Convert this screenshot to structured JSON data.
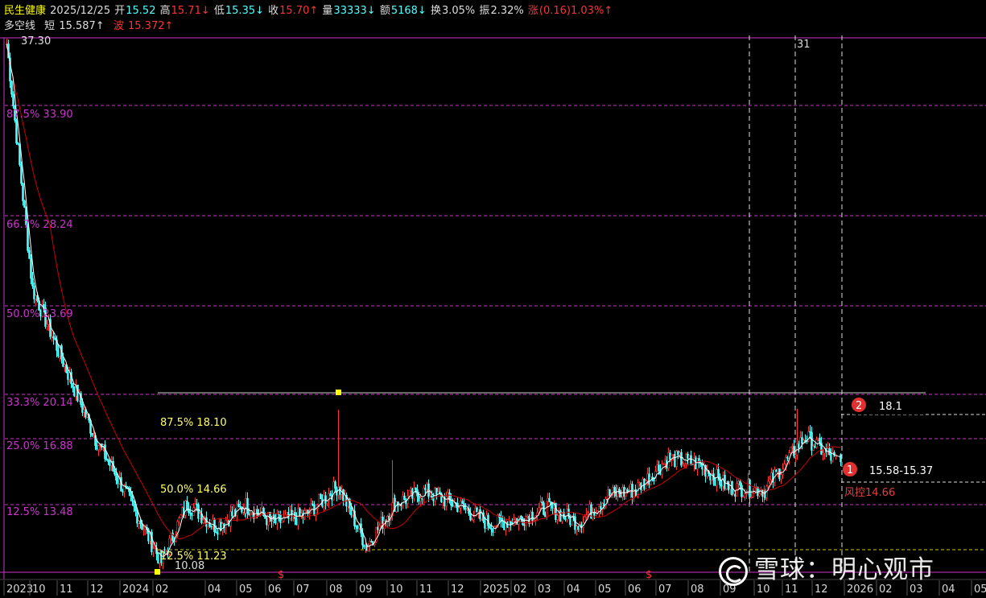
{
  "colors": {
    "bg": "#000000",
    "up": "#ff3232",
    "down": "#54ffff",
    "magenta": "#cc33cc",
    "yellow": "#ffff00",
    "white": "#ffffff",
    "grey": "#c8c8c8",
    "ma": "#cc0000"
  },
  "header": {
    "name": "民生健康",
    "date": "2025/12/25",
    "open_label": "开",
    "open_value": "15.52",
    "high_label": "高",
    "high_value": "15.71↓",
    "low_label": "低",
    "low_value": "15.35↓",
    "close_label": "收",
    "close_value": "15.70↑",
    "volume_label": "量",
    "volume_value": "33333↓",
    "amount_label": "额",
    "amount_value": "5168↓",
    "turnover_label": "换",
    "turnover_value": "3.05%",
    "amplitude_label": "振",
    "amplitude_value": "2.32%",
    "change_label": "涨",
    "change_value": "(0.16)1.03%↑"
  },
  "indicator": {
    "name": "多空线",
    "short_label": "短",
    "short_value": "15.587↑",
    "wave_label": "波",
    "wave_value": "15.372↑"
  },
  "price_axis_labels": {
    "top": "37.30",
    "l875": "87.5% 33.90",
    "l667": "66.7% 28.24",
    "l500": "50.0% 23.69",
    "l333": "33.3% 20.14",
    "l250": "25.0% 16.88",
    "l125": "12.5% 13.48"
  },
  "inner_fib": {
    "l875": "87.5% 18.10",
    "l500": "50.0% 14.66",
    "l125": "12.5% 11.23",
    "low": "10.08"
  },
  "vertical_marker": "31",
  "annotations": {
    "a2_num": "2",
    "a2_text": "18.1",
    "a1_num": "1",
    "a1_text": "15.58-15.37",
    "risk": "风控14.66"
  },
  "x_axis": [
    "2023",
    "10",
    "11",
    "12",
    "2024",
    "02",
    "04",
    "05",
    "06",
    "07",
    "08",
    "09",
    "10",
    "11",
    "12",
    "2025",
    "02",
    "03",
    "04",
    "05",
    "06",
    "07",
    "08",
    "09",
    "10",
    "11",
    "12",
    "2026",
    "02",
    "03",
    "04",
    "05"
  ],
  "watermark": "雪球：明心观市",
  "chart_data": {
    "type": "candlestick",
    "symbol": "民生健康",
    "last_bar": {
      "date": "2025/12/25",
      "open": 15.52,
      "high": 15.71,
      "low": 15.35,
      "close": 15.7,
      "volume": 33333,
      "amount": 5168,
      "turnover_pct": 3.05,
      "amplitude_pct": 2.32,
      "change": 0.16,
      "change_pct": 1.03
    },
    "price_range": [
      10.08,
      37.3
    ],
    "fib_levels": {
      "87.5%": 33.9,
      "66.7%": 28.24,
      "50.0%": 23.69,
      "33.3%": 20.14,
      "25.0%": 16.88,
      "12.5%": 13.48
    },
    "inner_fib_levels": {
      "87.5%": 18.1,
      "50.0%": 14.66,
      "12.5%": 11.23
    },
    "key_prices": {
      "target": 18.1,
      "support_zone": "15.58-15.37",
      "risk_control": 14.66,
      "low": 10.08
    },
    "approx_close_path": [
      {
        "d": "2023-09",
        "c": 37.0
      },
      {
        "d": "2023-10",
        "c": 24.5
      },
      {
        "d": "2023-11",
        "c": 20.6
      },
      {
        "d": "2023-12",
        "c": 16.9
      },
      {
        "d": "2024-01",
        "c": 13.8
      },
      {
        "d": "2024-02",
        "c": 10.6
      },
      {
        "d": "2024-03",
        "c": 13.6
      },
      {
        "d": "2024-04",
        "c": 12.4
      },
      {
        "d": "2024-05",
        "c": 13.5
      },
      {
        "d": "2024-06",
        "c": 12.6
      },
      {
        "d": "2024-07",
        "c": 13.0
      },
      {
        "d": "2024-08",
        "c": 14.5
      },
      {
        "d": "2024-09",
        "c": 11.4
      },
      {
        "d": "2024-10",
        "c": 13.6
      },
      {
        "d": "2024-11",
        "c": 14.2
      },
      {
        "d": "2024-12",
        "c": 13.5
      },
      {
        "d": "2025-01",
        "c": 12.5
      },
      {
        "d": "2025-02",
        "c": 12.8
      },
      {
        "d": "2025-03",
        "c": 13.4
      },
      {
        "d": "2025-04",
        "c": 12.6
      },
      {
        "d": "2025-05",
        "c": 14.0
      },
      {
        "d": "2025-06",
        "c": 14.3
      },
      {
        "d": "2025-07",
        "c": 15.9
      },
      {
        "d": "2025-08",
        "c": 15.6
      },
      {
        "d": "2025-09",
        "c": 14.4
      },
      {
        "d": "2025-10",
        "c": 14.3
      },
      {
        "d": "2025-11",
        "c": 17.0
      },
      {
        "d": "2025-12",
        "c": 15.7
      }
    ]
  }
}
